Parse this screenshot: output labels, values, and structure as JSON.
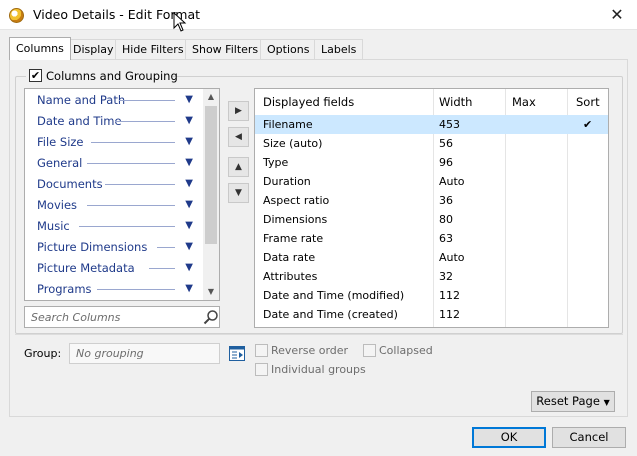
{
  "window": {
    "title": "Video Details - Edit Format",
    "close_glyph": "✕"
  },
  "tabs": [
    {
      "label": "Columns"
    },
    {
      "label": "Display"
    },
    {
      "label": "Hide Filters"
    },
    {
      "label": "Show Filters"
    },
    {
      "label": "Options"
    },
    {
      "label": "Labels"
    }
  ],
  "columns_grouping": {
    "label": "Columns and Grouping",
    "checked": true,
    "check_glyph": "✔"
  },
  "categories": [
    {
      "label": "Name and Path"
    },
    {
      "label": "Date and Time"
    },
    {
      "label": "File Size"
    },
    {
      "label": "General"
    },
    {
      "label": "Documents"
    },
    {
      "label": "Movies"
    },
    {
      "label": "Music"
    },
    {
      "label": "Picture Dimensions"
    },
    {
      "label": "Picture Metadata"
    },
    {
      "label": "Programs"
    }
  ],
  "search": {
    "placeholder": "Search Columns"
  },
  "fields_table": {
    "headers": {
      "displayed": "Displayed fields",
      "width": "Width",
      "max": "Max",
      "sort": "Sort"
    },
    "rows": [
      {
        "field": "Filename",
        "width": "453",
        "max": "",
        "sort": "✔",
        "selected": true
      },
      {
        "field": "Size (auto)",
        "width": "56",
        "max": "",
        "sort": ""
      },
      {
        "field": "Type",
        "width": "96",
        "max": "",
        "sort": ""
      },
      {
        "field": "Duration",
        "width": "Auto",
        "max": "",
        "sort": ""
      },
      {
        "field": "Aspect ratio",
        "width": "36",
        "max": "",
        "sort": ""
      },
      {
        "field": "Dimensions",
        "width": "80",
        "max": "",
        "sort": ""
      },
      {
        "field": "Frame rate",
        "width": "63",
        "max": "",
        "sort": ""
      },
      {
        "field": "Data rate",
        "width": "Auto",
        "max": "",
        "sort": ""
      },
      {
        "field": "Attributes",
        "width": "32",
        "max": "",
        "sort": ""
      },
      {
        "field": "Date and Time (modified)",
        "width": "112",
        "max": "",
        "sort": ""
      },
      {
        "field": "Date and Time (created)",
        "width": "112",
        "max": "",
        "sort": ""
      }
    ]
  },
  "grouping": {
    "label": "Group:",
    "value": "No grouping",
    "reverse_order": "Reverse order",
    "collapsed": "Collapsed",
    "individual_groups": "Individual groups"
  },
  "buttons": {
    "reset_page": "Reset Page",
    "ok": "OK",
    "cancel": "Cancel"
  },
  "colors": {
    "selection": "#cce8ff",
    "category_text": "#1f3a8a",
    "ok_border": "#0078d7"
  }
}
